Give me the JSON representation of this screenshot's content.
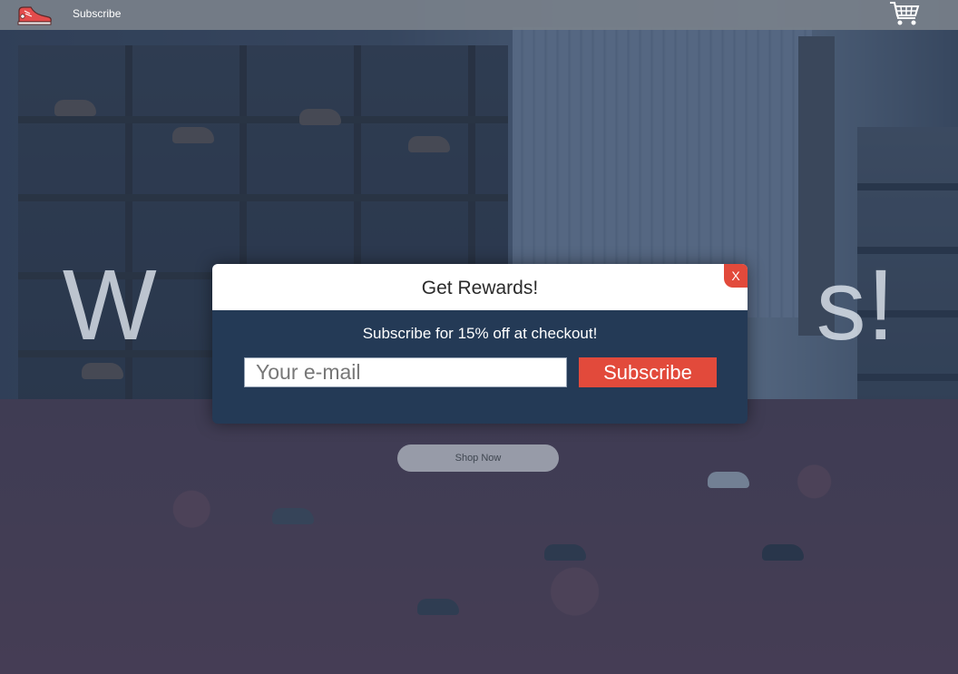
{
  "nav": {
    "logo_icon": "sneaker-logo-icon",
    "subscribe_link": "Subscribe",
    "cart_icon": "shopping-cart-icon"
  },
  "hero": {
    "title_visible": "W                       s!",
    "shop_now_label": "Shop Now"
  },
  "modal": {
    "title": "Get Rewards!",
    "close_label": "X",
    "subtitle": "Subscribe for 15% off at checkout!",
    "email_placeholder": "Your e-mail",
    "subscribe_label": "Subscribe"
  },
  "colors": {
    "accent": "#e24a3b",
    "modal_bg": "#243a56",
    "navbar": "#78808a"
  }
}
